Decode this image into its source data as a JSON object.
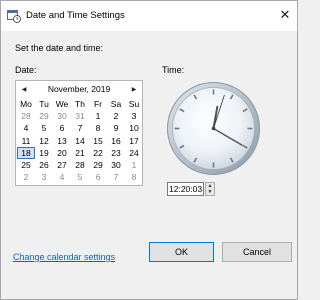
{
  "window": {
    "title": "Date and Time Settings",
    "close_symbol": "✕"
  },
  "instruction": "Set the date and time:",
  "date_label": "Date:",
  "time_label": "Time:",
  "calendar": {
    "month_label": "November, 2019",
    "prev_symbol": "◀",
    "next_symbol": "▶",
    "days_of_week": [
      "Mo",
      "Tu",
      "We",
      "Th",
      "Fr",
      "Sa",
      "Su"
    ],
    "weeks": [
      [
        "28",
        "29",
        "30",
        "31",
        "1",
        "2",
        "3"
      ],
      [
        "4",
        "5",
        "6",
        "7",
        "8",
        "9",
        "10"
      ],
      [
        "11",
        "12",
        "13",
        "14",
        "15",
        "16",
        "17"
      ],
      [
        "18",
        "19",
        "20",
        "21",
        "22",
        "23",
        "24"
      ],
      [
        "25",
        "26",
        "27",
        "28",
        "29",
        "30",
        "1"
      ],
      [
        "2",
        "3",
        "4",
        "5",
        "6",
        "7",
        "8"
      ]
    ],
    "selected_day": "18"
  },
  "clock": {
    "hour": 12,
    "minute": 20,
    "second": 3
  },
  "time_value": "12:20:03",
  "spinner": {
    "up_symbol": "▲",
    "down_symbol": "▼"
  },
  "change_calendar_link": "Change calendar settings",
  "buttons": {
    "ok": "OK",
    "cancel": "Cancel"
  },
  "colors": {
    "link": "#0066cc",
    "selection": "#cce4f7",
    "selection_border": "#3a6fb5"
  }
}
